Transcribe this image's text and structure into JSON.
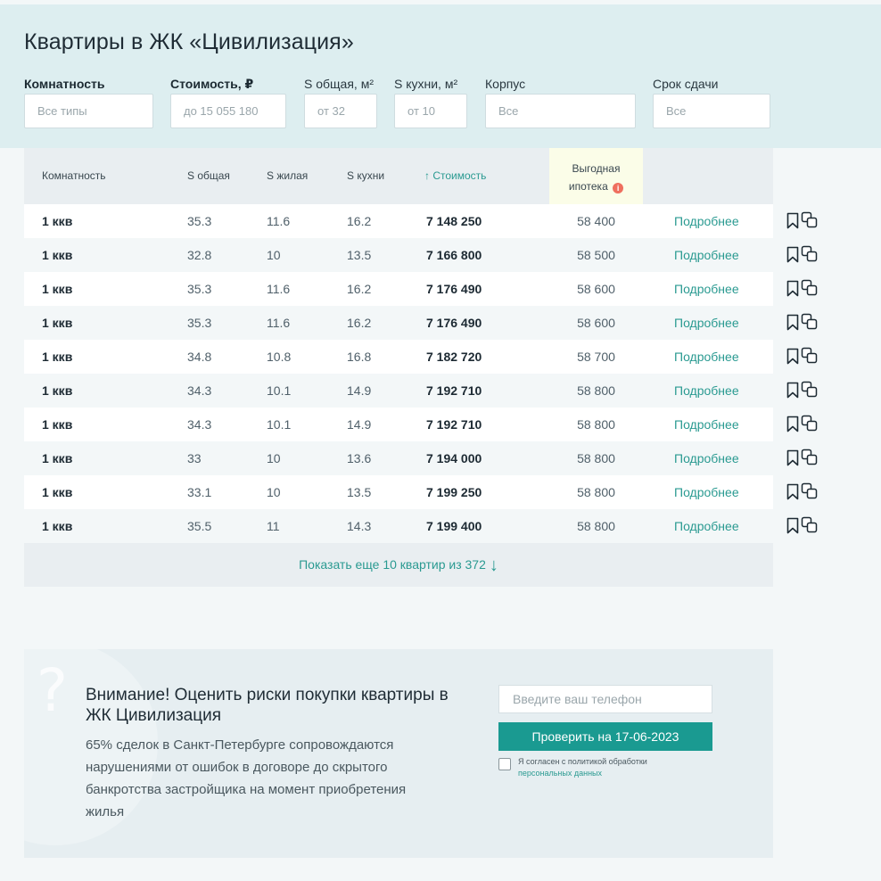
{
  "page": {
    "title": "Квартиры в ЖК «Цивилизация»"
  },
  "filters": {
    "rooms": {
      "label": "Комнатность",
      "placeholder": "Все типы"
    },
    "price": {
      "label": "Стоимость, ₽",
      "placeholder": "до 15 055 180"
    },
    "area_total": {
      "label": "S общая, м²",
      "placeholder": "от 32"
    },
    "area_kitchen": {
      "label": "S кухни, м²",
      "placeholder": "от 10"
    },
    "building": {
      "label": "Корпус",
      "placeholder": "Все"
    },
    "deadline": {
      "label": "Срок сдачи",
      "placeholder": "Все"
    }
  },
  "table": {
    "headers": {
      "rooms": "Комнатность",
      "area_total": "S общая",
      "area_living": "S жилая",
      "area_kitchen": "S кухни",
      "price": "↑ Стоимость",
      "mortgage_line1": "Выгодная",
      "mortgage_line2": "ипотека"
    },
    "rows": [
      {
        "rooms": "1 ккв",
        "total": "35.3",
        "living": "11.6",
        "kitchen": "16.2",
        "price": "7 148 250",
        "mortgage": "58 400",
        "link": "Подробнее"
      },
      {
        "rooms": "1 ккв",
        "total": "32.8",
        "living": "10",
        "kitchen": "13.5",
        "price": "7 166 800",
        "mortgage": "58 500",
        "link": "Подробнее"
      },
      {
        "rooms": "1 ккв",
        "total": "35.3",
        "living": "11.6",
        "kitchen": "16.2",
        "price": "7 176 490",
        "mortgage": "58 600",
        "link": "Подробнее"
      },
      {
        "rooms": "1 ккв",
        "total": "35.3",
        "living": "11.6",
        "kitchen": "16.2",
        "price": "7 176 490",
        "mortgage": "58 600",
        "link": "Подробнее"
      },
      {
        "rooms": "1 ккв",
        "total": "34.8",
        "living": "10.8",
        "kitchen": "16.8",
        "price": "7 182 720",
        "mortgage": "58 700",
        "link": "Подробнее"
      },
      {
        "rooms": "1 ккв",
        "total": "34.3",
        "living": "10.1",
        "kitchen": "14.9",
        "price": "7 192 710",
        "mortgage": "58 800",
        "link": "Подробнее"
      },
      {
        "rooms": "1 ккв",
        "total": "34.3",
        "living": "10.1",
        "kitchen": "14.9",
        "price": "7 192 710",
        "mortgage": "58 800",
        "link": "Подробнее"
      },
      {
        "rooms": "1 ккв",
        "total": "33",
        "living": "10",
        "kitchen": "13.6",
        "price": "7 194 000",
        "mortgage": "58 800",
        "link": "Подробнее"
      },
      {
        "rooms": "1 ккв",
        "total": "33.1",
        "living": "10",
        "kitchen": "13.5",
        "price": "7 199 250",
        "mortgage": "58 800",
        "link": "Подробнее"
      },
      {
        "rooms": "1 ккв",
        "total": "35.5",
        "living": "11",
        "kitchen": "14.3",
        "price": "7 199 400",
        "mortgage": "58 800",
        "link": "Подробнее"
      }
    ],
    "show_more": "Показать еще 10 квартир из 372",
    "show_more_arrow": "↓"
  },
  "risk": {
    "title": "Внимание! Оценить риски покупки квартиры в ЖК Цивилизация",
    "text": "65% сделок в Санкт-Петербурге сопровождаются нарушениями от ошибок в договоре до скрытого банкротства застройщика на момент приобретения жилья",
    "phone_placeholder": "Введите ваш телефон",
    "button": "Проверить на 17-06-2023",
    "consent_text": "Я согласен с политикой обработки",
    "consent_link": "персональных данных",
    "decor_glyph": "?"
  },
  "colors": {
    "accent": "#1a9a91",
    "link": "#2a9a91",
    "header_band": "#ddeef0",
    "mortgage_column": "#fbfde8",
    "info_icon": "#ef6f5e"
  },
  "icons": [
    "bookmark-icon",
    "compare-icon",
    "info-icon",
    "arrow-down-icon"
  ]
}
